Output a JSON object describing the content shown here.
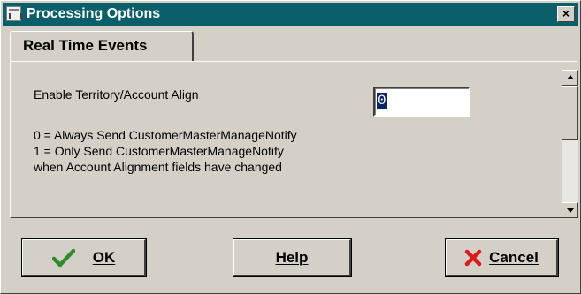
{
  "window": {
    "title": "Processing Options",
    "close_label": "×"
  },
  "tabs": [
    {
      "label": "Real Time Events"
    }
  ],
  "option": {
    "label": "Enable Territory/Account Align",
    "value": "0",
    "description": [
      "0 = Always Send CustomerMasterManageNotify",
      "1 = Only Send CustomerMasterManageNotify",
      "when Account Alignment fields have changed"
    ]
  },
  "buttons": {
    "ok": "OK",
    "help": "Help",
    "cancel": "Cancel"
  },
  "colors": {
    "title_bar": "#0a5f6a",
    "check": "#2e8b2e",
    "cancel_x": "#d81c1c"
  }
}
